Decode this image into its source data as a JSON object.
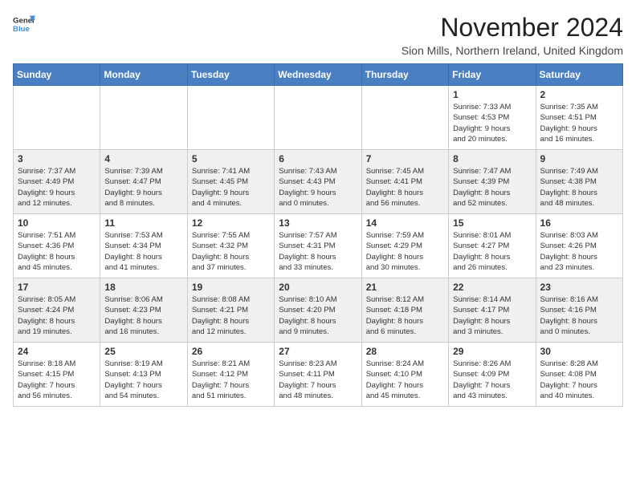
{
  "logo": {
    "general": "General",
    "blue": "Blue"
  },
  "title": "November 2024",
  "location": "Sion Mills, Northern Ireland, United Kingdom",
  "days_header": [
    "Sunday",
    "Monday",
    "Tuesday",
    "Wednesday",
    "Thursday",
    "Friday",
    "Saturday"
  ],
  "weeks": [
    [
      {
        "day": "",
        "info": ""
      },
      {
        "day": "",
        "info": ""
      },
      {
        "day": "",
        "info": ""
      },
      {
        "day": "",
        "info": ""
      },
      {
        "day": "",
        "info": ""
      },
      {
        "day": "1",
        "info": "Sunrise: 7:33 AM\nSunset: 4:53 PM\nDaylight: 9 hours\nand 20 minutes."
      },
      {
        "day": "2",
        "info": "Sunrise: 7:35 AM\nSunset: 4:51 PM\nDaylight: 9 hours\nand 16 minutes."
      }
    ],
    [
      {
        "day": "3",
        "info": "Sunrise: 7:37 AM\nSunset: 4:49 PM\nDaylight: 9 hours\nand 12 minutes."
      },
      {
        "day": "4",
        "info": "Sunrise: 7:39 AM\nSunset: 4:47 PM\nDaylight: 9 hours\nand 8 minutes."
      },
      {
        "day": "5",
        "info": "Sunrise: 7:41 AM\nSunset: 4:45 PM\nDaylight: 9 hours\nand 4 minutes."
      },
      {
        "day": "6",
        "info": "Sunrise: 7:43 AM\nSunset: 4:43 PM\nDaylight: 9 hours\nand 0 minutes."
      },
      {
        "day": "7",
        "info": "Sunrise: 7:45 AM\nSunset: 4:41 PM\nDaylight: 8 hours\nand 56 minutes."
      },
      {
        "day": "8",
        "info": "Sunrise: 7:47 AM\nSunset: 4:39 PM\nDaylight: 8 hours\nand 52 minutes."
      },
      {
        "day": "9",
        "info": "Sunrise: 7:49 AM\nSunset: 4:38 PM\nDaylight: 8 hours\nand 48 minutes."
      }
    ],
    [
      {
        "day": "10",
        "info": "Sunrise: 7:51 AM\nSunset: 4:36 PM\nDaylight: 8 hours\nand 45 minutes."
      },
      {
        "day": "11",
        "info": "Sunrise: 7:53 AM\nSunset: 4:34 PM\nDaylight: 8 hours\nand 41 minutes."
      },
      {
        "day": "12",
        "info": "Sunrise: 7:55 AM\nSunset: 4:32 PM\nDaylight: 8 hours\nand 37 minutes."
      },
      {
        "day": "13",
        "info": "Sunrise: 7:57 AM\nSunset: 4:31 PM\nDaylight: 8 hours\nand 33 minutes."
      },
      {
        "day": "14",
        "info": "Sunrise: 7:59 AM\nSunset: 4:29 PM\nDaylight: 8 hours\nand 30 minutes."
      },
      {
        "day": "15",
        "info": "Sunrise: 8:01 AM\nSunset: 4:27 PM\nDaylight: 8 hours\nand 26 minutes."
      },
      {
        "day": "16",
        "info": "Sunrise: 8:03 AM\nSunset: 4:26 PM\nDaylight: 8 hours\nand 23 minutes."
      }
    ],
    [
      {
        "day": "17",
        "info": "Sunrise: 8:05 AM\nSunset: 4:24 PM\nDaylight: 8 hours\nand 19 minutes."
      },
      {
        "day": "18",
        "info": "Sunrise: 8:06 AM\nSunset: 4:23 PM\nDaylight: 8 hours\nand 16 minutes."
      },
      {
        "day": "19",
        "info": "Sunrise: 8:08 AM\nSunset: 4:21 PM\nDaylight: 8 hours\nand 12 minutes."
      },
      {
        "day": "20",
        "info": "Sunrise: 8:10 AM\nSunset: 4:20 PM\nDaylight: 8 hours\nand 9 minutes."
      },
      {
        "day": "21",
        "info": "Sunrise: 8:12 AM\nSunset: 4:18 PM\nDaylight: 8 hours\nand 6 minutes."
      },
      {
        "day": "22",
        "info": "Sunrise: 8:14 AM\nSunset: 4:17 PM\nDaylight: 8 hours\nand 3 minutes."
      },
      {
        "day": "23",
        "info": "Sunrise: 8:16 AM\nSunset: 4:16 PM\nDaylight: 8 hours\nand 0 minutes."
      }
    ],
    [
      {
        "day": "24",
        "info": "Sunrise: 8:18 AM\nSunset: 4:15 PM\nDaylight: 7 hours\nand 56 minutes."
      },
      {
        "day": "25",
        "info": "Sunrise: 8:19 AM\nSunset: 4:13 PM\nDaylight: 7 hours\nand 54 minutes."
      },
      {
        "day": "26",
        "info": "Sunrise: 8:21 AM\nSunset: 4:12 PM\nDaylight: 7 hours\nand 51 minutes."
      },
      {
        "day": "27",
        "info": "Sunrise: 8:23 AM\nSunset: 4:11 PM\nDaylight: 7 hours\nand 48 minutes."
      },
      {
        "day": "28",
        "info": "Sunrise: 8:24 AM\nSunset: 4:10 PM\nDaylight: 7 hours\nand 45 minutes."
      },
      {
        "day": "29",
        "info": "Sunrise: 8:26 AM\nSunset: 4:09 PM\nDaylight: 7 hours\nand 43 minutes."
      },
      {
        "day": "30",
        "info": "Sunrise: 8:28 AM\nSunset: 4:08 PM\nDaylight: 7 hours\nand 40 minutes."
      }
    ]
  ]
}
